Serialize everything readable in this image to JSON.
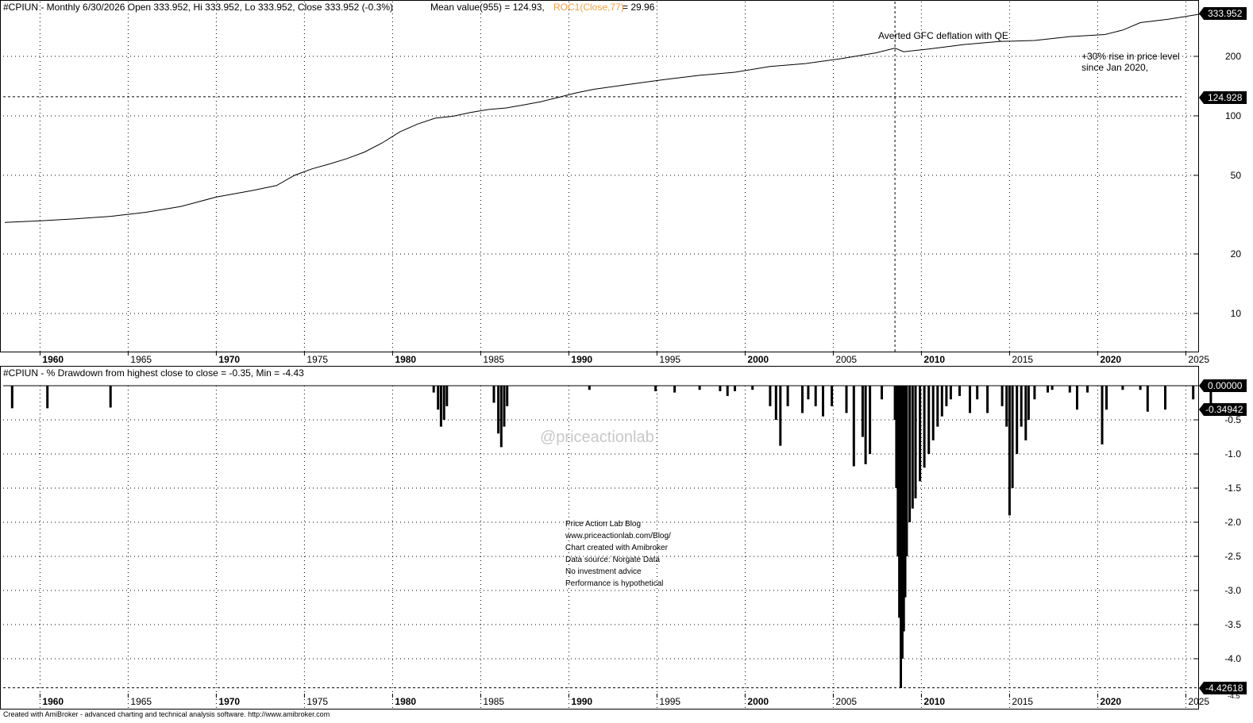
{
  "top_panel": {
    "header_ticker": "#CPIUN - Monthly 6/30/2026 Open 333.952, Hi 333.952, Lo 333.952, Close 333.952 (-0.3%)",
    "header_mean": "Mean value(955) = 124.93,",
    "header_roc_label": "ROC1(Close,77)",
    "header_roc_value": " = 29.96",
    "last_price_tag": "333.952",
    "mean_tag": "124.928",
    "annotation_gfc": "Averted GFC deflation with QE",
    "annotation_rise_1": "+30% rise in price level",
    "annotation_rise_2": "since Jan 2020,"
  },
  "bottom_panel": {
    "header": "#CPIUN - % Drawdown from highest close to close  = -0.35, Min  = -4.43",
    "zero_tag": "0.00000",
    "last_tag": "-0.34942",
    "min_tag": "-4.42618",
    "watermark": "@priceactionlab",
    "info_lines": [
      "Price Action Lab Blog",
      "www.priceactionlab.com/Blog/",
      "Chart created with Amibroker",
      "Data source: Norgate Data",
      "No investment advice",
      "Performance is hypothetical"
    ],
    "cut_label": "-4.5"
  },
  "footer": "Created with AmiBroker - advanced charting and technical analysis software. http://www.amibroker.com",
  "colors": {
    "roc": "#f0a040",
    "tag_bg": "#000000",
    "line": "#000000",
    "watermark": "#c8c8c8"
  },
  "chart_data": [
    {
      "type": "line",
      "series": [
        {
          "x": [
            "1958-01",
            "1960-01",
            "1962-01",
            "1964-01",
            "1966-01",
            "1968-01",
            "1970-01",
            "1972-01",
            "1973-06",
            "1974-06",
            "1975-06",
            "1976-06",
            "1977-06",
            "1978-06",
            "1979-06",
            "1980-06",
            "1981-06",
            "1982-06",
            "1983-06",
            "1984-06",
            "1985-06",
            "1986-06",
            "1987-06",
            "1988-06",
            "1989-06",
            "1990-06",
            "1991-06",
            "1993-06",
            "1995-06",
            "1997-06",
            "1999-06",
            "2001-06",
            "2003-06",
            "2005-06",
            "2007-06",
            "2008-07",
            "2009-01",
            "2010-06",
            "2012-06",
            "2014-06",
            "2016-06",
            "2018-06",
            "2020-06",
            "2021-06",
            "2022-06",
            "2024-01",
            "2026-06"
          ],
          "values": [
            28.9,
            29.4,
            30.1,
            31.0,
            32.5,
            34.8,
            38.8,
            41.8,
            44.4,
            49.9,
            53.9,
            57.1,
            60.8,
            65.6,
            73.0,
            83.0,
            90.9,
            97.3,
            99.5,
            103.9,
            107.6,
            109.5,
            113.5,
            118.0,
            124.1,
            130.7,
            136.2,
            144.4,
            152.5,
            160.3,
            166.2,
            177.7,
            183.9,
            194.5,
            208.4,
            219.9,
            211.1,
            218.0,
            229.5,
            237.7,
            240.6,
            251.9,
            257.8,
            271.7,
            296.3,
            308.4,
            333.952
          ]
        }
      ],
      "xlim": [
        "1958-01",
        "2026-06"
      ],
      "y_scale": "log",
      "yticks": [
        10,
        20,
        50,
        100,
        200
      ],
      "x_ticks": [
        "1960",
        "1965",
        "1970",
        "1975",
        "1980",
        "1985",
        "1990",
        "1995",
        "2000",
        "2005",
        "2010",
        "2015",
        "2020",
        "2025"
      ],
      "reference_lines": [
        {
          "axis": "y",
          "value": 124.928,
          "style": "dashed"
        },
        {
          "axis": "x",
          "value": "2008-07",
          "style": "dashed"
        }
      ],
      "grid": true
    },
    {
      "type": "bar",
      "bars": [
        {
          "x": "1958-06",
          "v": -0.33
        },
        {
          "x": "1960-06",
          "v": -0.33
        },
        {
          "x": "1964-01",
          "v": -0.32
        },
        {
          "x": "1982-05",
          "v": -0.1
        },
        {
          "x": "1982-08",
          "v": -0.35
        },
        {
          "x": "1982-10",
          "v": -0.6
        },
        {
          "x": "1982-12",
          "v": -0.5
        },
        {
          "x": "1983-02",
          "v": -0.3
        },
        {
          "x": "1985-10",
          "v": -0.25
        },
        {
          "x": "1986-01",
          "v": -0.7
        },
        {
          "x": "1986-03",
          "v": -0.9
        },
        {
          "x": "1986-05",
          "v": -0.6
        },
        {
          "x": "1986-07",
          "v": -0.3
        },
        {
          "x": "1991-03",
          "v": -0.06
        },
        {
          "x": "1994-12",
          "v": -0.08
        },
        {
          "x": "1996-01",
          "v": -0.1
        },
        {
          "x": "1997-06",
          "v": -0.06
        },
        {
          "x": "1998-08",
          "v": -0.08
        },
        {
          "x": "1999-01",
          "v": -0.15
        },
        {
          "x": "1999-06",
          "v": -0.08
        },
        {
          "x": "2000-06",
          "v": -0.06
        },
        {
          "x": "2001-06",
          "v": -0.3
        },
        {
          "x": "2001-10",
          "v": -0.5
        },
        {
          "x": "2002-01",
          "v": -0.88
        },
        {
          "x": "2002-06",
          "v": -0.3
        },
        {
          "x": "2003-04",
          "v": -0.4
        },
        {
          "x": "2003-08",
          "v": -0.2
        },
        {
          "x": "2004-01",
          "v": -0.3
        },
        {
          "x": "2004-06",
          "v": -0.45
        },
        {
          "x": "2004-12",
          "v": -0.3
        },
        {
          "x": "2005-10",
          "v": -0.4
        },
        {
          "x": "2006-03",
          "v": -1.18
        },
        {
          "x": "2006-09",
          "v": -0.75
        },
        {
          "x": "2006-11",
          "v": -1.15
        },
        {
          "x": "2007-02",
          "v": -1.0
        },
        {
          "x": "2007-10",
          "v": -0.2
        },
        {
          "x": "2008-07",
          "v": -0.5
        },
        {
          "x": "2008-08",
          "v": -1.5
        },
        {
          "x": "2008-09",
          "v": -2.5
        },
        {
          "x": "2008-10",
          "v": -3.4
        },
        {
          "x": "2008-11",
          "v": -4.43
        },
        {
          "x": "2008-12",
          "v": -4.0
        },
        {
          "x": "2009-01",
          "v": -3.6
        },
        {
          "x": "2009-02",
          "v": -3.1
        },
        {
          "x": "2009-03",
          "v": -2.5
        },
        {
          "x": "2009-05",
          "v": -2.0
        },
        {
          "x": "2009-07",
          "v": -1.8
        },
        {
          "x": "2009-09",
          "v": -1.65
        },
        {
          "x": "2009-12",
          "v": -1.4
        },
        {
          "x": "2010-03",
          "v": -1.2
        },
        {
          "x": "2010-06",
          "v": -1.0
        },
        {
          "x": "2010-09",
          "v": -0.8
        },
        {
          "x": "2010-12",
          "v": -0.6
        },
        {
          "x": "2011-03",
          "v": -0.45
        },
        {
          "x": "2011-06",
          "v": -0.3
        },
        {
          "x": "2011-09",
          "v": -0.2
        },
        {
          "x": "2012-03",
          "v": -0.15
        },
        {
          "x": "2012-10",
          "v": -0.4
        },
        {
          "x": "2013-03",
          "v": -0.2
        },
        {
          "x": "2013-10",
          "v": -0.4
        },
        {
          "x": "2014-08",
          "v": -0.3
        },
        {
          "x": "2014-11",
          "v": -0.6
        },
        {
          "x": "2015-01",
          "v": -1.9
        },
        {
          "x": "2015-03",
          "v": -1.5
        },
        {
          "x": "2015-06",
          "v": -1.0
        },
        {
          "x": "2015-09",
          "v": -0.6
        },
        {
          "x": "2015-12",
          "v": -0.8
        },
        {
          "x": "2016-02",
          "v": -0.5
        },
        {
          "x": "2016-06",
          "v": -0.2
        },
        {
          "x": "2017-03",
          "v": -0.1
        },
        {
          "x": "2017-06",
          "v": -0.06
        },
        {
          "x": "2018-06",
          "v": -0.1
        },
        {
          "x": "2018-11",
          "v": -0.35
        },
        {
          "x": "2019-06",
          "v": -0.1
        },
        {
          "x": "2020-04",
          "v": -0.86
        },
        {
          "x": "2020-07",
          "v": -0.35
        },
        {
          "x": "2021-06",
          "v": -0.06
        },
        {
          "x": "2022-06",
          "v": -0.06
        },
        {
          "x": "2022-11",
          "v": -0.38
        },
        {
          "x": "2023-11",
          "v": -0.35
        },
        {
          "x": "2025-06",
          "v": -0.2
        },
        {
          "x": "2026-06",
          "v": -0.35
        }
      ],
      "ylim": [
        -4.5,
        0
      ],
      "yticks": [
        -0.5,
        -1.0,
        -1.5,
        -2.0,
        -2.5,
        -3.0,
        -3.5,
        -4.0
      ],
      "x_ticks": [
        "1960",
        "1965",
        "1970",
        "1975",
        "1980",
        "1985",
        "1990",
        "1995",
        "2000",
        "2005",
        "2010",
        "2015",
        "2020",
        "2025"
      ],
      "reference_lines": [
        {
          "axis": "y",
          "value": -4.42618,
          "style": "dashed"
        }
      ],
      "grid": true
    }
  ]
}
